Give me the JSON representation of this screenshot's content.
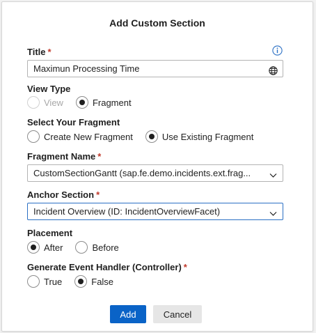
{
  "dialog": {
    "title": "Add Custom Section"
  },
  "title_field": {
    "label": "Title",
    "required_mark": "*",
    "value": "Maximun Processing Time"
  },
  "view_type": {
    "label": "View Type",
    "options": [
      "View",
      "Fragment"
    ],
    "selected": "Fragment"
  },
  "fragment_select": {
    "label": "Select Your Fragment",
    "options": [
      "Create New Fragment",
      "Use Existing Fragment"
    ],
    "selected": "Use Existing Fragment"
  },
  "fragment_name": {
    "label": "Fragment Name",
    "required_mark": "*",
    "value": "CustomSectionGantt (sap.fe.demo.incidents.ext.frag..."
  },
  "anchor_section": {
    "label": "Anchor Section",
    "required_mark": "*",
    "value": "Incident Overview (ID: IncidentOverviewFacet)"
  },
  "placement": {
    "label": "Placement",
    "options": [
      "After",
      "Before"
    ],
    "selected": "After"
  },
  "event_handler": {
    "label": "Generate Event Handler (Controller)",
    "required_mark": "*",
    "options": [
      "True",
      "False"
    ],
    "selected": "False"
  },
  "buttons": {
    "add": "Add",
    "cancel": "Cancel"
  },
  "colors": {
    "primary": "#0a63c7",
    "required": "#c0392b",
    "focus_border": "#2a6fc4"
  },
  "icons": {
    "info": "info-icon",
    "translate": "globe-icon",
    "dropdown": "chevron-down-icon"
  }
}
